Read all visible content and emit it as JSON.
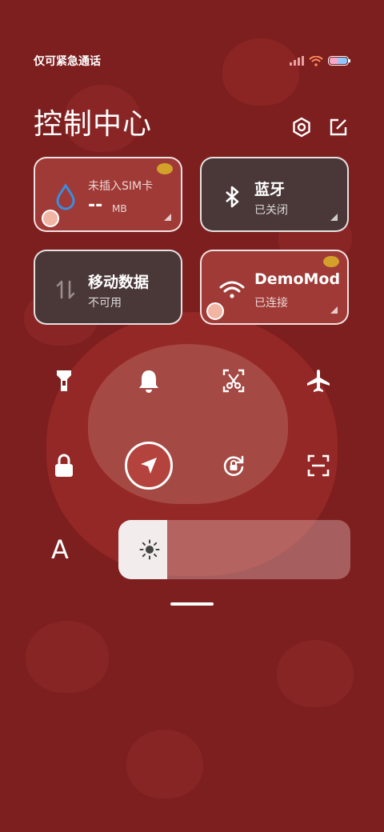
{
  "status_bar": {
    "carrier_text": "仅可紧急通话",
    "icons": [
      "signal-icon",
      "wifi-icon",
      "battery-icon"
    ]
  },
  "header": {
    "title": "控制中心",
    "settings_icon": "gear-icon",
    "edit_icon": "edit-icon"
  },
  "tiles": [
    {
      "id": "sim",
      "main": "--",
      "unit": "MB",
      "sub_top": "未插入SIM卡",
      "icon": "water-drop-icon",
      "state": "on"
    },
    {
      "id": "bluetooth",
      "main": "蓝牙",
      "sub": "已关闭",
      "icon": "bluetooth-icon",
      "state": "off"
    },
    {
      "id": "mobile-data",
      "main": "移动数据",
      "sub": "不可用",
      "icon": "data-arrows-icon",
      "state": "off"
    },
    {
      "id": "wifi",
      "main": "DemoMod",
      "sub": "已连接",
      "icon": "wifi-icon",
      "state": "on"
    }
  ],
  "quick_toggles_row1": [
    "flashlight-icon",
    "bell-icon",
    "screenshot-scissors-icon",
    "airplane-icon"
  ],
  "quick_toggles_row2": [
    "lock-icon",
    "location-icon",
    "rotation-lock-icon",
    "scan-icon"
  ],
  "font_button_label": "A",
  "brightness": {
    "level": 0.21,
    "icon": "sun-icon"
  },
  "colors": {
    "background": "#7d1f1f",
    "tile_active": "#a03a36",
    "tile_inactive": "#4a3838",
    "accent_blue": "#3b8de0"
  }
}
